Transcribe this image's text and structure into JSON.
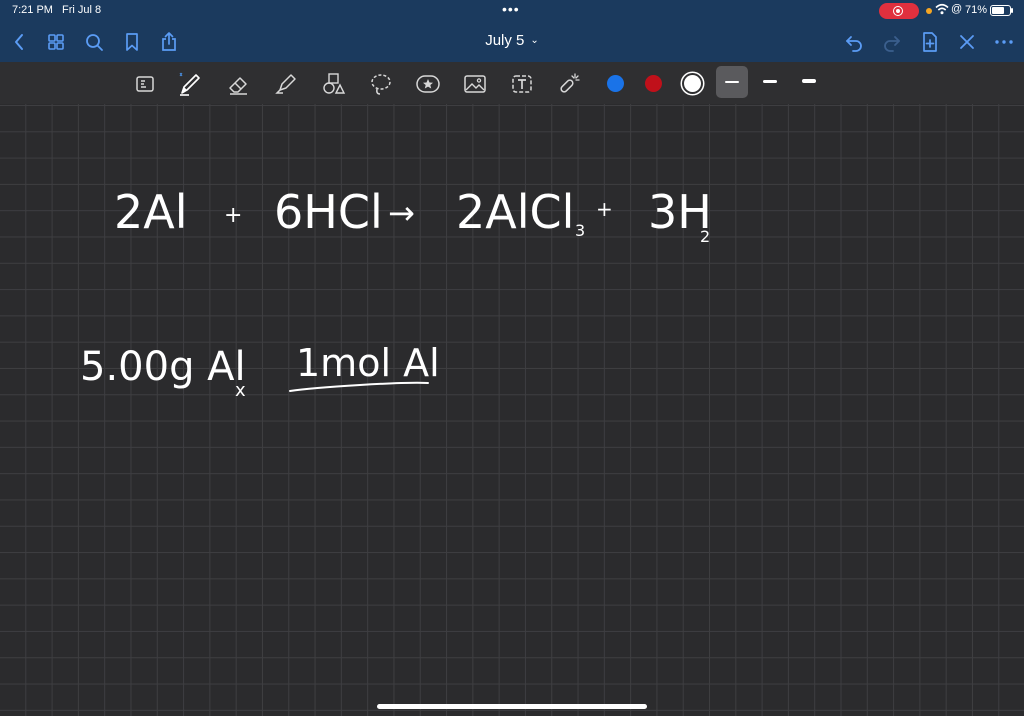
{
  "status_bar": {
    "time": "7:21 PM",
    "date": "Fri Jul 8",
    "multitask_dots": "•••",
    "battery_percent": "71%",
    "battery_level": 0.71
  },
  "nav": {
    "title": "July 5",
    "left_icons": [
      "back-icon",
      "grid-icon",
      "search-icon",
      "bookmark-icon",
      "share-icon"
    ],
    "right_icons": [
      "undo-icon",
      "redo-icon",
      "add-page-icon",
      "close-icon",
      "more-icon"
    ]
  },
  "toolbar": {
    "tools": [
      "read-only-icon",
      "pen-icon",
      "eraser-icon",
      "highlighter-icon",
      "shapes-icon",
      "lasso-icon",
      "elements-icon",
      "image-icon",
      "text-icon",
      "laser-pointer-icon"
    ],
    "colors": [
      "#1a73e8",
      "#c0101a",
      "#ffffff"
    ],
    "selected_color": "#ffffff",
    "stroke_widths": [
      "thin",
      "medium",
      "thick"
    ],
    "selected_width": "thin"
  },
  "note": {
    "line1": {
      "term1": "2Al",
      "plus1": "+",
      "term2": "6HCl",
      "arrow": "→",
      "term3": "2AlCl",
      "term3_sub": "3",
      "plus2": "+",
      "term4": "3H",
      "term4_sub": "2"
    },
    "line2": {
      "mass": "5.00g Al",
      "times": "x",
      "numerator": "1mol Al"
    }
  }
}
